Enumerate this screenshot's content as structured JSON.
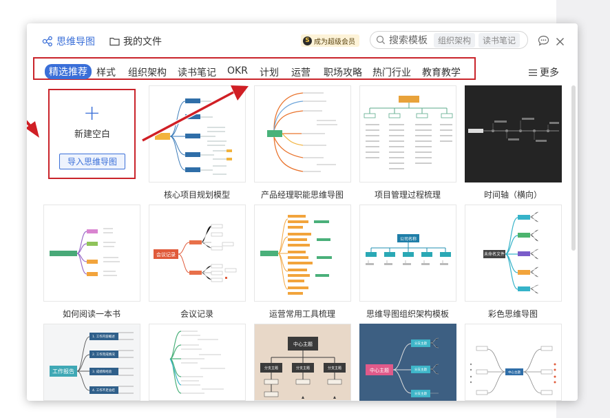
{
  "header": {
    "tab_mindmap": "思维导图",
    "tab_files": "我的文件",
    "vip_label": "成为超级会员",
    "vip_coin": "S",
    "search_placeholder": "搜索模板",
    "search_chips": [
      "组织架构",
      "读书笔记"
    ]
  },
  "categories": [
    "精选推荐",
    "样式",
    "组织架构",
    "读书笔记",
    "OKR",
    "计划",
    "运营",
    "职场攻略",
    "热门行业",
    "教育教学"
  ],
  "more_label": "更多",
  "new_blank": {
    "title": "新建空白",
    "import_label": "导入思维导图"
  },
  "templates": [
    {
      "label": "核心项目规划模型"
    },
    {
      "label": "产品经理职能思维导图"
    },
    {
      "label": "项目管理过程梳理"
    },
    {
      "label": "时间轴（横向）"
    },
    {
      "label": "如何阅读一本书"
    },
    {
      "label": "会议记录",
      "node": "会议记录"
    },
    {
      "label": "运营常用工具梳理"
    },
    {
      "label": "思维导图组织架构模板",
      "node": "公司名称"
    },
    {
      "label": "彩色思维导图",
      "node": "未命名文件"
    },
    {
      "label": "",
      "node": "工作报告",
      "items": [
        "1. 工作内容概述",
        "2. 工作完成情况",
        "3. 成绩和经验",
        "4. 工作不足总结"
      ]
    },
    {
      "label": ""
    },
    {
      "label": "",
      "node": "中心主题",
      "items": [
        "分支主题",
        "分支主题",
        "分支主题"
      ]
    },
    {
      "label": "",
      "node": "中心主题",
      "items": [
        "分支主题",
        "分支主题",
        "分支主题"
      ]
    },
    {
      "label": "",
      "node": "中心主题"
    }
  ],
  "colors": {
    "accent": "#3a6fd8",
    "highlight": "#c9232a"
  }
}
